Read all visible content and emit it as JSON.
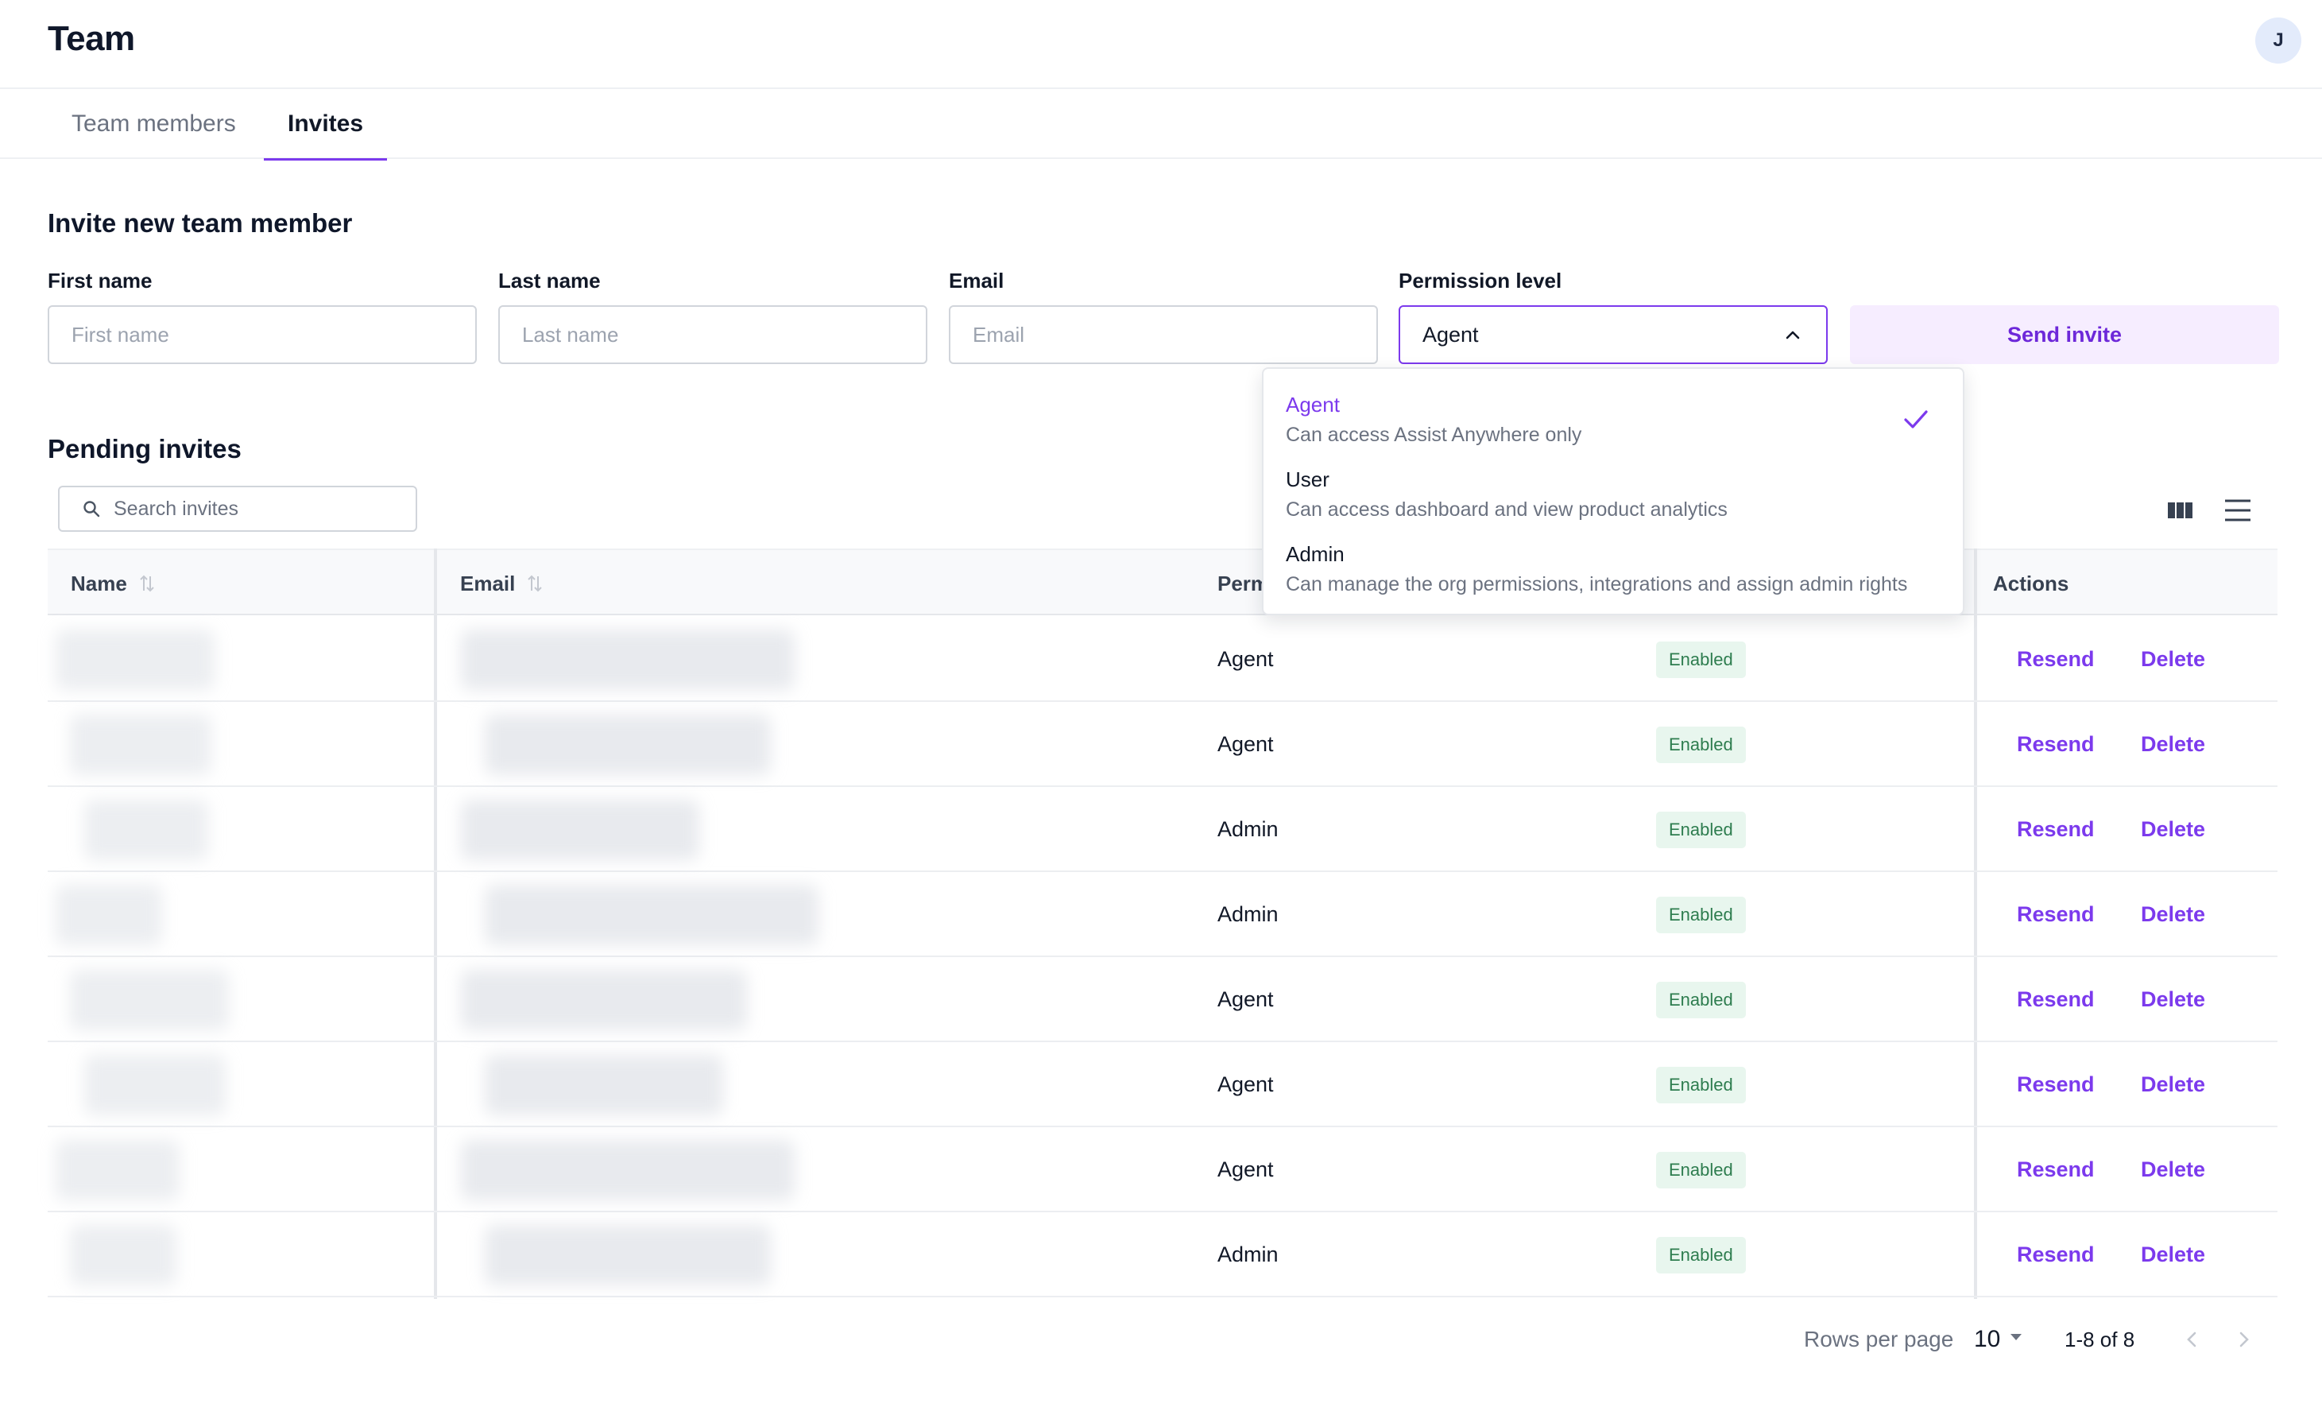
{
  "header": {
    "title": "Team",
    "avatar_initial": "J"
  },
  "tabs": [
    {
      "label": "Team members",
      "active": false
    },
    {
      "label": "Invites",
      "active": true
    }
  ],
  "invite_form": {
    "title": "Invite new team member",
    "first_name": {
      "label": "First name",
      "placeholder": "First name",
      "value": ""
    },
    "last_name": {
      "label": "Last name",
      "placeholder": "Last name",
      "value": ""
    },
    "email": {
      "label": "Email",
      "placeholder": "Email",
      "value": ""
    },
    "permission": {
      "label": "Permission level",
      "value": "Agent"
    },
    "send_label": "Send invite"
  },
  "permission_options": [
    {
      "title": "Agent",
      "description": "Can access Assist Anywhere only",
      "selected": true
    },
    {
      "title": "User",
      "description": "Can access dashboard and view product analytics",
      "selected": false
    },
    {
      "title": "Admin",
      "description": "Can manage the org permissions, integrations and assign admin rights",
      "selected": false
    }
  ],
  "pending": {
    "title": "Pending invites",
    "search_placeholder": "Search invites",
    "columns": {
      "name": "Name",
      "email": "Email",
      "permission": "Perm",
      "actions": "Actions"
    },
    "rows": [
      {
        "permission": "Agent",
        "status": "Enabled",
        "resend": "Resend",
        "delete": "Delete"
      },
      {
        "permission": "Agent",
        "status": "Enabled",
        "resend": "Resend",
        "delete": "Delete"
      },
      {
        "permission": "Admin",
        "status": "Enabled",
        "resend": "Resend",
        "delete": "Delete"
      },
      {
        "permission": "Admin",
        "status": "Enabled",
        "resend": "Resend",
        "delete": "Delete"
      },
      {
        "permission": "Agent",
        "status": "Enabled",
        "resend": "Resend",
        "delete": "Delete"
      },
      {
        "permission": "Agent",
        "status": "Enabled",
        "resend": "Resend",
        "delete": "Delete"
      },
      {
        "permission": "Agent",
        "status": "Enabled",
        "resend": "Resend",
        "delete": "Delete"
      },
      {
        "permission": "Admin",
        "status": "Enabled",
        "resend": "Resend",
        "delete": "Delete"
      }
    ]
  },
  "pagination": {
    "rows_per_page_label": "Rows per page",
    "rows_per_page": "10",
    "range": "1-8 of 8"
  },
  "colors": {
    "accent": "#7c3aed",
    "success_bg": "#e8f6ee",
    "success_text": "#2e7d4f"
  }
}
